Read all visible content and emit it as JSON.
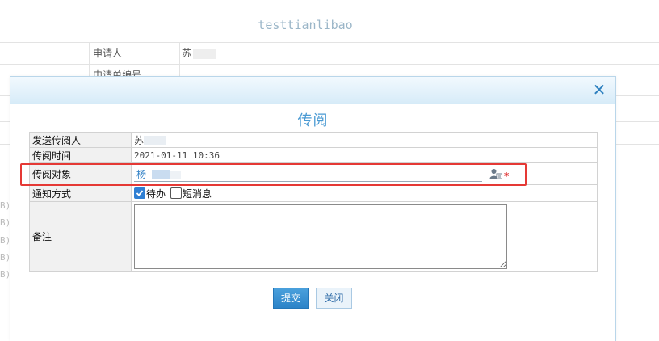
{
  "background": {
    "title": "testtianlibao",
    "rows": [
      {
        "label": "申请人",
        "value": "苏"
      },
      {
        "label": "申请单编号",
        "value": "..."
      }
    ],
    "side_marks": [
      "B)",
      "B)",
      "B)",
      "B)",
      "B)"
    ]
  },
  "dialog": {
    "title": "传阅",
    "close_icon": "close-icon",
    "fields": {
      "sender": {
        "label": "发送传阅人",
        "value": "苏"
      },
      "time": {
        "label": "传阅时间",
        "value": "2021-01-11 10:36"
      },
      "recipient": {
        "label": "传阅对象",
        "value": "杨",
        "required_mark": "*"
      },
      "notify": {
        "label": "通知方式",
        "options": [
          {
            "label": "待办",
            "checked": true
          },
          {
            "label": "短消息",
            "checked": false
          }
        ]
      },
      "remarks": {
        "label": "备注",
        "value": ""
      }
    },
    "buttons": {
      "submit": "提交",
      "close": "关闭"
    }
  },
  "colors": {
    "accent": "#4a9ad3",
    "submit_button": "#2c83c8",
    "highlight": "#e53935",
    "required": "#e03030"
  }
}
